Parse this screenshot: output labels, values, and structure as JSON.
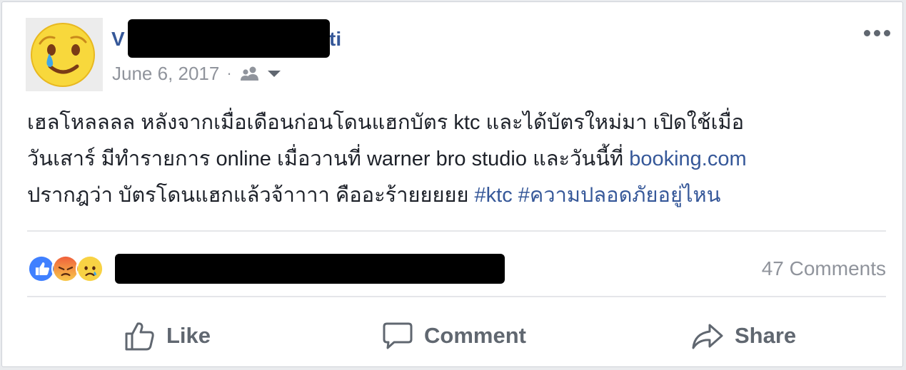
{
  "post": {
    "author_visible_start": "V",
    "author_visible_end": "ti",
    "date": "June 6, 2017",
    "separator": "·",
    "audience_icon": "friends-icon",
    "text_lines": [
      "เฮลโหลลลล หลังจากเมื่อเดือนก่อนโดนแฮกบัตร ktc และได้บัตรใหม่มา เปิดใช้เมื่อ",
      "วันเสาร์ มีทำรายการ online เมื่อวานที่ warner bro studio และวันนี้ที่ ",
      "ปรากฎว่า บัตรโดนแฮกแล้วจ้าาาา คืออะร้ายยยยย "
    ],
    "link_text": "booking.com",
    "hashtags": "#ktc #ความปลอดภัยอยู่ไหน",
    "comments_count": "47 Comments"
  },
  "actions": {
    "like": "Like",
    "comment": "Comment",
    "share": "Share"
  },
  "icons": {
    "more": "more-options-icon",
    "like": "thumbs-up-icon",
    "comment": "speech-bubble-icon",
    "share": "share-arrow-icon"
  },
  "colors": {
    "link": "#365899",
    "text": "#1d2129",
    "muted": "#90949c",
    "like_blue": "#4080ff"
  }
}
